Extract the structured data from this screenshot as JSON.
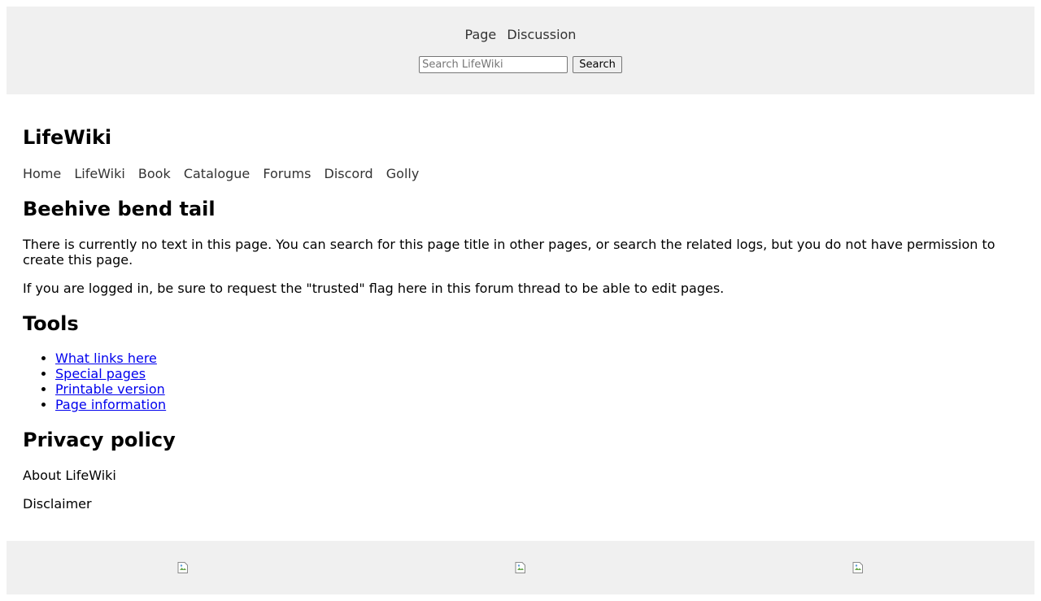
{
  "header": {
    "tabs": [
      {
        "label": "Page"
      },
      {
        "label": "Discussion"
      }
    ],
    "search": {
      "placeholder": "Search LifeWiki",
      "value": "",
      "button_label": "Search"
    }
  },
  "site": {
    "title": "LifeWiki",
    "nav": [
      {
        "label": "Home"
      },
      {
        "label": "LifeWiki"
      },
      {
        "label": "Book"
      },
      {
        "label": "Catalogue"
      },
      {
        "label": "Forums"
      },
      {
        "label": "Discord"
      },
      {
        "label": "Golly"
      }
    ]
  },
  "main": {
    "page_title": "Beehive bend tail",
    "paragraphs": [
      "There is currently no text in this page. You can search for this page title in other pages, or search the related logs, but you do not have permission to create this page.",
      "If you are logged in, be sure to request the \"trusted\" flag here in this forum thread to be able to edit pages."
    ]
  },
  "tools": {
    "heading": "Tools",
    "links": [
      {
        "label": "What links here"
      },
      {
        "label": "Special pages"
      },
      {
        "label": "Printable version"
      },
      {
        "label": "Page information"
      }
    ]
  },
  "footer": {
    "privacy_heading": "Privacy policy",
    "about": "About LifeWiki",
    "disclaimer": "Disclaimer",
    "images": [
      {
        "icon": "broken-image-icon"
      },
      {
        "icon": "broken-image-icon"
      },
      {
        "icon": "broken-image-icon"
      }
    ]
  },
  "colors": {
    "bar_background": "#f0f0f0",
    "link": "#0000ee",
    "nav_text": "#333333"
  }
}
